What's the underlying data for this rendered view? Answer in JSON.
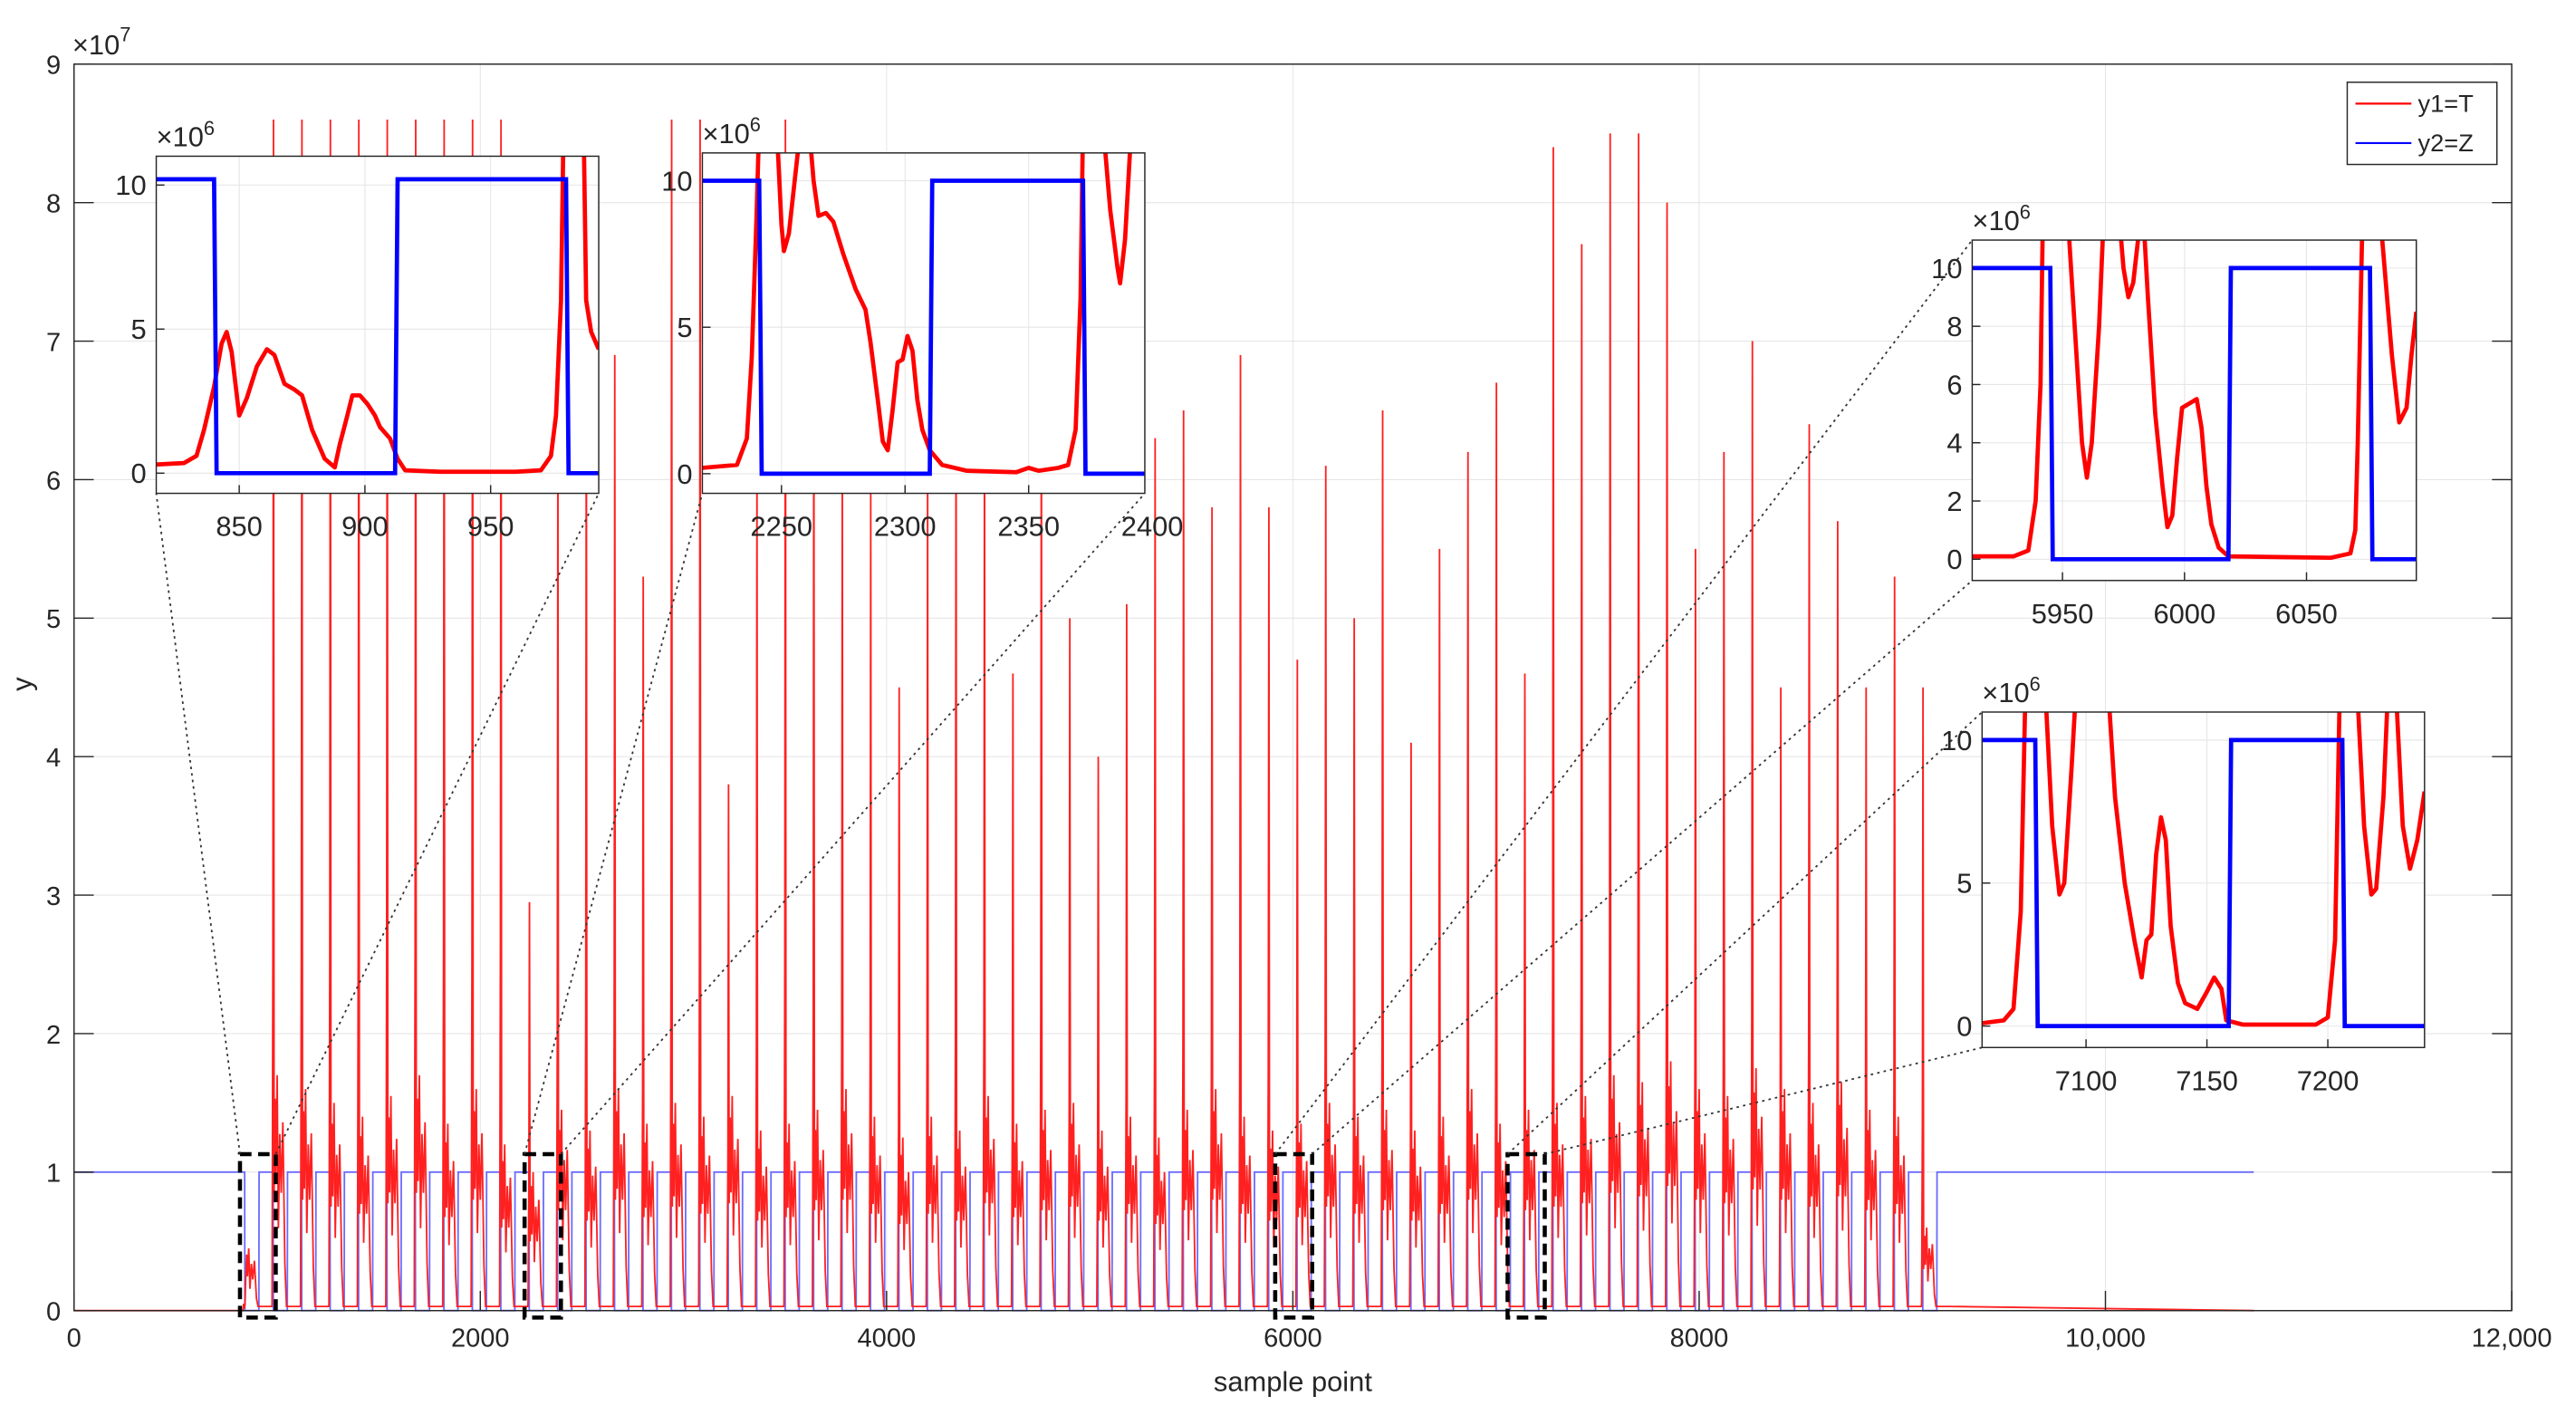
{
  "chart_data": {
    "type": "line",
    "xlabel": "sample point",
    "ylabel": "y",
    "y_exponent_label": "×10",
    "y_exponent_power": "7",
    "xlim": [
      0,
      12000
    ],
    "ylim": [
      0,
      9
    ],
    "y_units": 10000000,
    "xticks": [
      0,
      2000,
      4000,
      6000,
      8000,
      10000,
      12000
    ],
    "xtick_labels": [
      "0",
      "2000",
      "4000",
      "6000",
      "8000",
      "10,000",
      "12,000"
    ],
    "yticks": [
      0,
      1,
      2,
      3,
      4,
      5,
      6,
      7,
      8,
      9
    ],
    "ytick_labels": [
      "0",
      "1",
      "2",
      "3",
      "4",
      "5",
      "6",
      "7",
      "8",
      "9"
    ],
    "grid": true,
    "legend": {
      "placement": "top-right",
      "entries": [
        {
          "label": "y1=T",
          "color": "#ff0000"
        },
        {
          "label": "y2=Z",
          "color": "#0000ff"
        }
      ]
    },
    "series": [
      {
        "name": "y1=T",
        "color": "#ff0000",
        "description_values": "spike per cycle (×1e7)",
        "cycle_start": 840,
        "cycle_period": 140,
        "cycles": 60,
        "end_x": 10730,
        "spike_peaks": [
          0.05,
          8.6,
          8.6,
          8.6,
          8.6,
          8.6,
          8.6,
          8.6,
          8.6,
          8.6,
          2.95,
          6.5,
          7.1,
          6.9,
          5.3,
          8.6,
          8.6,
          3.8,
          6.3,
          8.6,
          7.2,
          6.3,
          5.9,
          4.5,
          6.0,
          6.8,
          6.6,
          4.6,
          7.1,
          5.0,
          4.0,
          5.1,
          6.3,
          6.5,
          5.8,
          6.9,
          5.8,
          4.7,
          6.1,
          5.0,
          6.5,
          4.1,
          5.5,
          6.2,
          6.7,
          4.6,
          8.4,
          7.7,
          8.5,
          8.5,
          8.0,
          5.5,
          6.2,
          7.0,
          4.5,
          6.4,
          5.7,
          4.5,
          5.3,
          4.5
        ],
        "secondary_peaks": [
          0.45,
          1.7,
          1.6,
          1.5,
          1.4,
          1.55,
          1.7,
          1.35,
          1.6,
          1.2,
          1.0,
          1.45,
          1.3,
          1.6,
          1.35,
          1.5,
          1.4,
          1.55,
          1.3,
          1.35,
          1.45,
          1.6,
          1.4,
          1.25,
          1.4,
          1.3,
          1.55,
          1.35,
          1.45,
          1.5,
          1.3,
          1.4,
          1.25,
          1.45,
          1.6,
          1.4,
          1.3,
          1.35,
          1.5,
          1.4,
          1.45,
          1.3,
          1.4,
          1.6,
          1.35,
          1.45,
          1.5,
          1.55,
          1.7,
          1.65,
          1.8,
          1.6,
          1.55,
          1.75,
          1.6,
          1.5,
          1.65,
          1.45,
          1.4,
          0.6
        ]
      },
      {
        "name": "y2=Z",
        "color": "#0000ff",
        "high": 1,
        "low": 0,
        "cycle_start": 840,
        "cycle_period": 140,
        "low_duration": 70,
        "cycles": 60,
        "end_x": 10730
      }
    ],
    "insets": [
      {
        "exponent_label": "×10",
        "exponent_power": "6",
        "xlim": [
          817,
          993
        ],
        "ylim": [
          -0.7,
          11
        ],
        "xticks": [
          850,
          900,
          950
        ],
        "xtick_labels": [
          "850",
          "900",
          "950"
        ],
        "yticks": [
          0,
          5,
          10
        ],
        "ytick_labels": [
          "0",
          "5",
          "10"
        ],
        "zoom_ylim": [
          -0.05,
          1.13
        ],
        "blue": [
          [
            817,
            10.2
          ],
          [
            840,
            10.2
          ],
          [
            841,
            0
          ],
          [
            912,
            0
          ],
          [
            913,
            10.2
          ],
          [
            980,
            10.2
          ],
          [
            981,
            0
          ],
          [
            993,
            0
          ]
        ],
        "red": [
          [
            817,
            0.3
          ],
          [
            828,
            0.35
          ],
          [
            833,
            0.6
          ],
          [
            836,
            1.5
          ],
          [
            840,
            3
          ],
          [
            843,
            4.5
          ],
          [
            845,
            4.9
          ],
          [
            847,
            4.2
          ],
          [
            850,
            2.0
          ],
          [
            853,
            2.6
          ],
          [
            857,
            3.7
          ],
          [
            861,
            4.3
          ],
          [
            864,
            4.1
          ],
          [
            868,
            3.1
          ],
          [
            872,
            2.9
          ],
          [
            875,
            2.7
          ],
          [
            879,
            1.5
          ],
          [
            884,
            0.5
          ],
          [
            888,
            0.2
          ],
          [
            890,
            1.0
          ],
          [
            893,
            2.0
          ],
          [
            895,
            2.7
          ],
          [
            898,
            2.7
          ],
          [
            901,
            2.4
          ],
          [
            904,
            2.0
          ],
          [
            906,
            1.6
          ],
          [
            910,
            1.2
          ],
          [
            913,
            0.5
          ],
          [
            916,
            0.1
          ],
          [
            930,
            0.05
          ],
          [
            960,
            0.05
          ],
          [
            970,
            0.1
          ],
          [
            974,
            0.6
          ],
          [
            976,
            2
          ],
          [
            978,
            6
          ],
          [
            979,
            12
          ],
          [
            987,
            12
          ],
          [
            988,
            6
          ],
          [
            990,
            4.9
          ],
          [
            993,
            4.3
          ]
        ]
      },
      {
        "exponent_label": "×10",
        "exponent_power": "6",
        "xlim": [
          2218,
          2397
        ],
        "ylim": [
          -0.67,
          10.95
        ],
        "xticks": [
          2250,
          2300,
          2350,
          2400
        ],
        "xtick_labels": [
          "2250",
          "2300",
          "2350",
          "2400"
        ],
        "yticks": [
          0,
          5,
          10
        ],
        "ytick_labels": [
          "0",
          "5",
          "10"
        ],
        "zoom_ylim": [
          -0.05,
          1.13
        ],
        "blue": [
          [
            2218,
            10
          ],
          [
            2241,
            10
          ],
          [
            2242,
            0
          ],
          [
            2310,
            0
          ],
          [
            2311,
            10
          ],
          [
            2372,
            10
          ],
          [
            2373,
            0
          ],
          [
            2397,
            0
          ]
        ],
        "red": [
          [
            2218,
            0.2
          ],
          [
            2232,
            0.3
          ],
          [
            2236,
            1.2
          ],
          [
            2238,
            4
          ],
          [
            2240,
            9
          ],
          [
            2241,
            12
          ],
          [
            2248,
            12
          ],
          [
            2250,
            8.5
          ],
          [
            2251,
            7.6
          ],
          [
            2253,
            8.2
          ],
          [
            2256,
            10.5
          ],
          [
            2258,
            12
          ],
          [
            2261,
            12
          ],
          [
            2263,
            10
          ],
          [
            2265,
            8.8
          ],
          [
            2268,
            8.9
          ],
          [
            2271,
            8.6
          ],
          [
            2275,
            7.5
          ],
          [
            2280,
            6.3
          ],
          [
            2284,
            5.6
          ],
          [
            2286,
            4.5
          ],
          [
            2289,
            2.5
          ],
          [
            2291,
            1.1
          ],
          [
            2293,
            0.8
          ],
          [
            2295,
            2.2
          ],
          [
            2297,
            3.8
          ],
          [
            2299,
            3.9
          ],
          [
            2301,
            4.7
          ],
          [
            2303,
            4.2
          ],
          [
            2305,
            2.5
          ],
          [
            2307,
            1.5
          ],
          [
            2310,
            0.8
          ],
          [
            2315,
            0.3
          ],
          [
            2325,
            0.1
          ],
          [
            2345,
            0.05
          ],
          [
            2350,
            0.2
          ],
          [
            2354,
            0.1
          ],
          [
            2362,
            0.2
          ],
          [
            2366,
            0.3
          ],
          [
            2369,
            1.5
          ],
          [
            2371,
            6
          ],
          [
            2372,
            12
          ],
          [
            2380,
            12
          ],
          [
            2383,
            9
          ],
          [
            2386,
            7
          ],
          [
            2387,
            6.5
          ],
          [
            2389,
            8
          ],
          [
            2391,
            11
          ],
          [
            2392,
            12
          ]
        ]
      },
      {
        "exponent_label": "×10",
        "exponent_power": "6",
        "xlim": [
          5913,
          6095
        ],
        "ylim": [
          -0.73,
          10.96
        ],
        "xticks": [
          5950,
          6000,
          6050
        ],
        "xtick_labels": [
          "5950",
          "6000",
          "6050"
        ],
        "yticks": [
          0,
          2,
          4,
          6,
          8,
          10
        ],
        "ytick_labels": [
          "0",
          "2",
          "4",
          "6",
          "8",
          "10"
        ],
        "zoom_ylim": [
          -0.05,
          1.13
        ],
        "blue": [
          [
            5913,
            10
          ],
          [
            5945,
            10
          ],
          [
            5946,
            0
          ],
          [
            6018,
            0
          ],
          [
            6019,
            10
          ],
          [
            6076,
            10
          ],
          [
            6077,
            0
          ],
          [
            6095,
            0
          ]
        ],
        "red": [
          [
            5913,
            0.1
          ],
          [
            5930,
            0.1
          ],
          [
            5936,
            0.3
          ],
          [
            5939,
            2
          ],
          [
            5941,
            6
          ],
          [
            5942,
            12
          ],
          [
            5952,
            12
          ],
          [
            5955,
            8
          ],
          [
            5958,
            4
          ],
          [
            5960,
            2.8
          ],
          [
            5962,
            4
          ],
          [
            5965,
            8
          ],
          [
            5967,
            12
          ],
          [
            5973,
            12
          ],
          [
            5975,
            10
          ],
          [
            5977,
            9
          ],
          [
            5979,
            9.5
          ],
          [
            5981,
            11
          ],
          [
            5983,
            12
          ],
          [
            5985,
            9
          ],
          [
            5988,
            5
          ],
          [
            5991,
            2.5
          ],
          [
            5993,
            1.1
          ],
          [
            5995,
            1.5
          ],
          [
            5997,
            3.5
          ],
          [
            5999,
            5.2
          ],
          [
            6003,
            5.4
          ],
          [
            6005,
            5.5
          ],
          [
            6007,
            4.5
          ],
          [
            6009,
            2.5
          ],
          [
            6011,
            1.2
          ],
          [
            6014,
            0.4
          ],
          [
            6018,
            0.1
          ],
          [
            6060,
            0.05
          ],
          [
            6068,
            0.2
          ],
          [
            6070,
            1
          ],
          [
            6071,
            4
          ],
          [
            6073,
            12
          ],
          [
            6080,
            12
          ],
          [
            6085,
            7
          ],
          [
            6088,
            4.7
          ],
          [
            6091,
            5.2
          ],
          [
            6093,
            7
          ],
          [
            6095,
            8.5
          ]
        ]
      },
      {
        "exponent_label": "×10",
        "exponent_power": "6",
        "xlim": [
          7057,
          7240
        ],
        "ylim": [
          -0.75,
          10.98
        ],
        "xticks": [
          7100,
          7150,
          7200
        ],
        "xtick_labels": [
          "7100",
          "7150",
          "7200"
        ],
        "yticks": [
          0,
          5,
          10
        ],
        "ytick_labels": [
          "0",
          "5",
          "10"
        ],
        "zoom_ylim": [
          -0.05,
          1.13
        ],
        "blue": [
          [
            7057,
            10
          ],
          [
            7079,
            10
          ],
          [
            7080,
            0
          ],
          [
            7159,
            0
          ],
          [
            7160,
            10
          ],
          [
            7206,
            10
          ],
          [
            7207,
            0
          ],
          [
            7240,
            0
          ]
        ],
        "red": [
          [
            7057,
            0.1
          ],
          [
            7066,
            0.2
          ],
          [
            7070,
            0.6
          ],
          [
            7073,
            4
          ],
          [
            7075,
            12
          ],
          [
            7083,
            12
          ],
          [
            7086,
            7
          ],
          [
            7089,
            4.6
          ],
          [
            7091,
            5
          ],
          [
            7094,
            9
          ],
          [
            7096,
            12
          ],
          [
            7109,
            12
          ],
          [
            7112,
            8
          ],
          [
            7116,
            5
          ],
          [
            7120,
            3
          ],
          [
            7123,
            1.7
          ],
          [
            7125,
            3
          ],
          [
            7127,
            3.2
          ],
          [
            7129,
            6
          ],
          [
            7131,
            7.3
          ],
          [
            7133,
            6.5
          ],
          [
            7135,
            3.5
          ],
          [
            7138,
            1.5
          ],
          [
            7141,
            0.8
          ],
          [
            7146,
            0.6
          ],
          [
            7150,
            1.2
          ],
          [
            7153,
            1.7
          ],
          [
            7156,
            1.3
          ],
          [
            7158,
            0.2
          ],
          [
            7165,
            0.05
          ],
          [
            7195,
            0.05
          ],
          [
            7200,
            0.3
          ],
          [
            7203,
            3
          ],
          [
            7205,
            12
          ],
          [
            7212,
            12
          ],
          [
            7215,
            7
          ],
          [
            7218,
            4.6
          ],
          [
            7220,
            4.8
          ],
          [
            7223,
            8
          ],
          [
            7225,
            12
          ],
          [
            7228,
            12
          ],
          [
            7231,
            7
          ],
          [
            7234,
            5.5
          ],
          [
            7237,
            6.5
          ],
          [
            7240,
            8.2
          ]
        ]
      }
    ]
  }
}
